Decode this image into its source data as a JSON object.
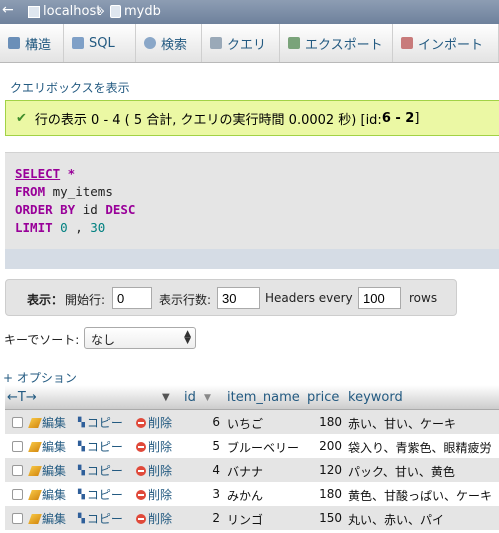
{
  "breadcrumb": {
    "back": "←",
    "server": "localhost",
    "sep": "»",
    "db": "mydb"
  },
  "tabs": [
    {
      "label": "構造",
      "icon": "structure-icon",
      "color": "#6b8fb8"
    },
    {
      "label": "SQL",
      "icon": "sql-icon",
      "color": "#7fa0c7"
    },
    {
      "label": "検索",
      "icon": "search-icon",
      "color": "#8aa7c8"
    },
    {
      "label": "クエリ",
      "icon": "query-icon",
      "color": "#9aa9b8"
    },
    {
      "label": "エクスポート",
      "icon": "export-icon",
      "color": "#7aa37a"
    },
    {
      "label": "インポート",
      "icon": "import-icon",
      "color": "#c87a7a"
    }
  ],
  "query_box_link": "クエリボックスを表示",
  "success": {
    "prefix": "行の表示 0 - 4 ( 5 合計, クエリの実行時間 0.0002 秒) [id: ",
    "bold": "6 - 2",
    "suffix": "]"
  },
  "sql": {
    "select": "SELECT",
    "star": " *",
    "from": "FROM",
    "table": " my_items",
    "order_by": "ORDER BY",
    "order_col": " id ",
    "desc": "DESC",
    "limit": "LIMIT",
    "offset": " 0",
    "comma": " , ",
    "count": "30"
  },
  "nav": {
    "show_label": "表示：",
    "start_label": "開始行:",
    "start_value": "0",
    "rows_label": "表示行数:",
    "rows_value": "30",
    "headers_label": "Headers every",
    "headers_value": "100",
    "rows_unit": "rows"
  },
  "sort": {
    "label": "キーでソート:",
    "selected": "なし"
  },
  "options_link": "+ オプション",
  "table": {
    "arrows": "←T→",
    "columns": [
      "id",
      "item_name",
      "price",
      "keyword"
    ],
    "actions": {
      "edit": "編集",
      "copy": "コピー",
      "delete": "削除"
    },
    "rows": [
      {
        "id": "6",
        "item_name": "いちご",
        "price": "180",
        "keyword": "赤い、甘い、ケーキ"
      },
      {
        "id": "5",
        "item_name": "ブルーベリー",
        "price": "200",
        "keyword": "袋入り、青紫色、眼精疲労"
      },
      {
        "id": "4",
        "item_name": "バナナ",
        "price": "120",
        "keyword": "パック、甘い、黄色"
      },
      {
        "id": "3",
        "item_name": "みかん",
        "price": "180",
        "keyword": "黄色、甘酸っぱい、ケーキ"
      },
      {
        "id": "2",
        "item_name": "リンゴ",
        "price": "150",
        "keyword": "丸い、赤い、パイ"
      }
    ]
  },
  "colors": {
    "link": "#235a81",
    "success_bg": "#ebf8a4",
    "success_border": "#a2d246",
    "sql_keyword": "#990099",
    "sql_number": "#008080"
  }
}
